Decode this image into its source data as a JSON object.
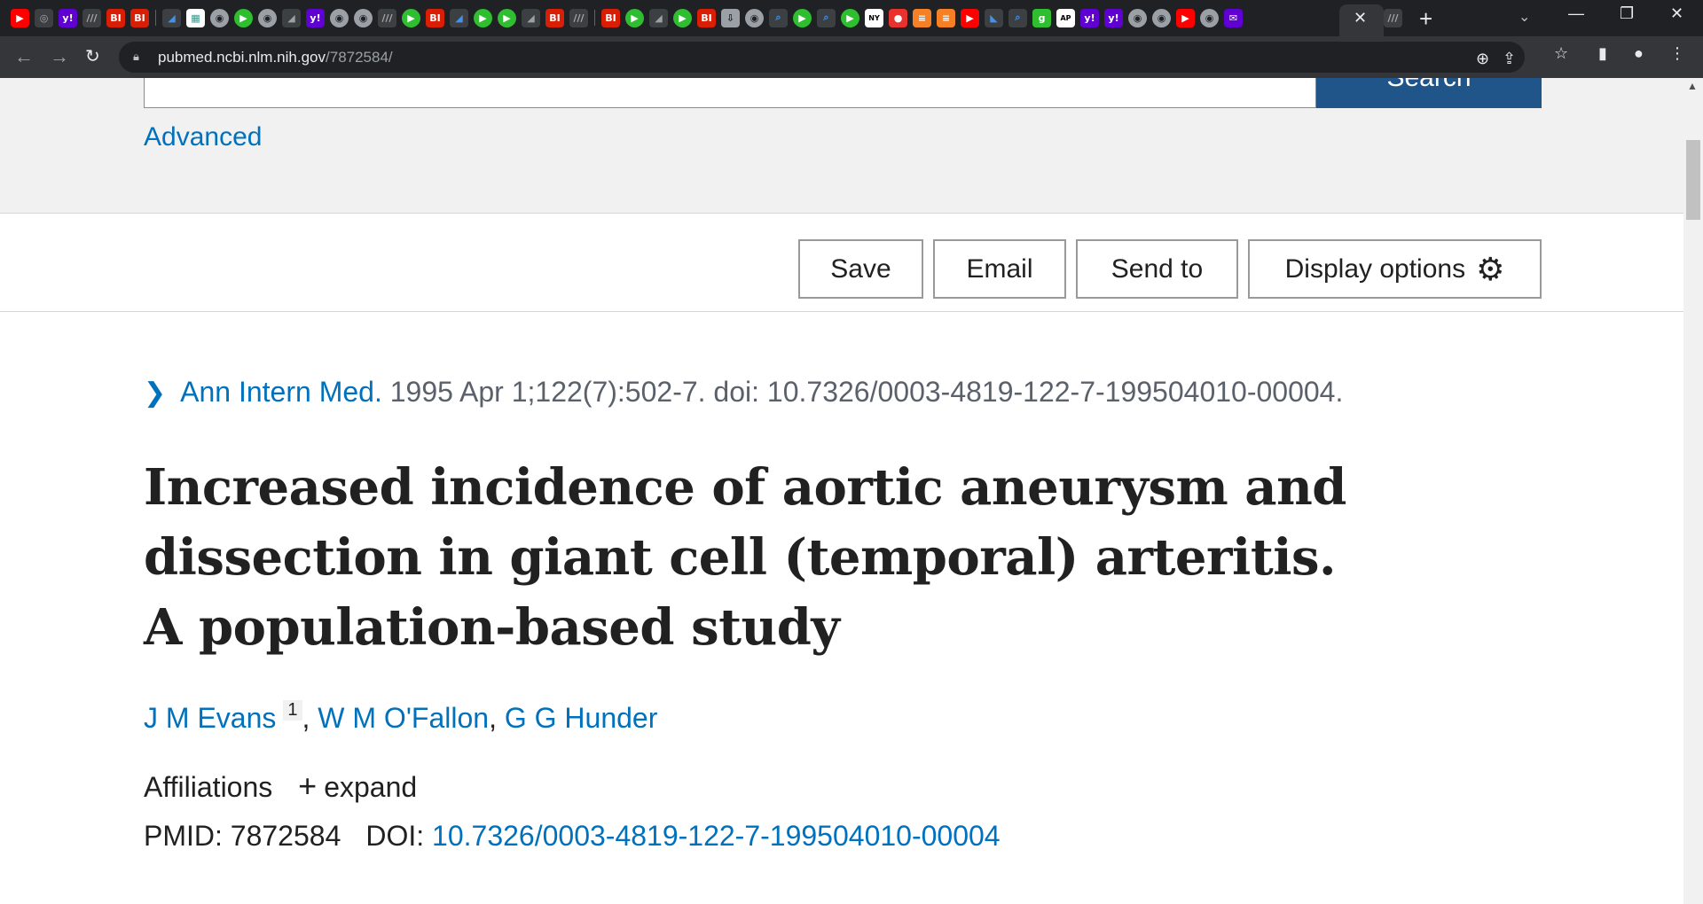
{
  "browser": {
    "url_host": "pubmed.ncbi.nlm.nih.gov",
    "url_path": "/7872584/",
    "tab_favicons": [
      "youtube",
      "generic",
      "yahoo",
      "generic",
      "BI",
      "BI",
      "generic",
      "generic",
      "grid",
      "globe",
      "play",
      "globe",
      "generic",
      "yahoo",
      "globe",
      "globe",
      "generic",
      "play",
      "BI",
      "generic",
      "play",
      "play",
      "generic",
      "BI",
      "generic",
      "generic",
      "BI",
      "play",
      "generic",
      "play",
      "BI",
      "download",
      "globe",
      "search",
      "play",
      "search",
      "play",
      "generic",
      "pin",
      "bookmark",
      "bookmark",
      "youtube",
      "generic",
      "search",
      "g",
      "generic",
      "yahoo",
      "yahoo",
      "globe",
      "globe",
      "youtube",
      "globe",
      "mail"
    ],
    "new_tab_label": "+",
    "close_tab_label": "✕"
  },
  "search": {
    "button_label": "Search",
    "advanced_label": "Advanced"
  },
  "actions": {
    "save": "Save",
    "email": "Email",
    "send_to": "Send to",
    "display_options": "Display options"
  },
  "article": {
    "journal": "Ann Intern Med.",
    "citation_rest": " 1995 Apr 1;122(7):502-7. doi: 10.7326/0003-4819-122-7-199504010-00004.",
    "title": "Increased incidence of aortic aneurysm and dissection in giant cell (temporal) arteritis. A population-based study",
    "authors": [
      {
        "name": "J M Evans",
        "sup": "1"
      },
      {
        "name": "W M O'Fallon"
      },
      {
        "name": "G G Hunder"
      }
    ],
    "affiliations_label": "Affiliations",
    "expand_label": "expand",
    "pmid_label": "PMID:",
    "pmid": "7872584",
    "doi_label": "DOI:",
    "doi": "10.7326/0003-4819-122-7-199504010-00004"
  },
  "colors": {
    "link": "#0071bc",
    "search_button": "#20558a",
    "text": "#212121"
  }
}
